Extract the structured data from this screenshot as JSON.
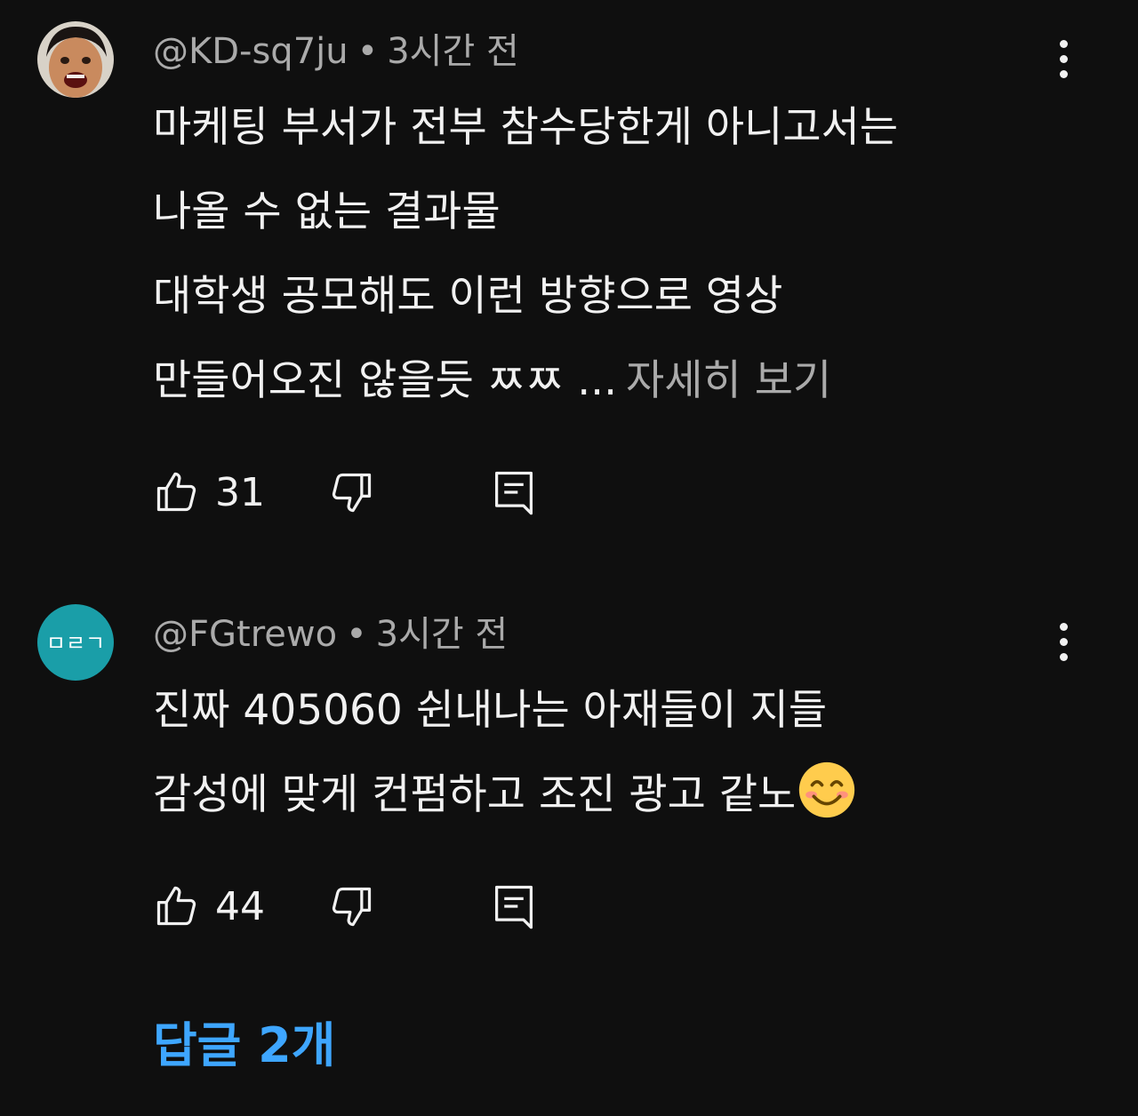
{
  "comments": [
    {
      "author": "@KD-sq7ju",
      "separator": "•",
      "time": "3시간 전",
      "lines": [
        "마케팅 부서가 전부 참수당한게 아니고서는",
        "나올 수 없는 결과물",
        "대학생 공모해도 이런 방향으로 영상",
        "만들어오진 않을듯 ㅉㅉ ..."
      ],
      "more_label": "자세히 보기",
      "likes": "31",
      "avatar_icon": "person-photo-avatar"
    },
    {
      "author": "@FGtrewo",
      "separator": "•",
      "time": "3시간 전",
      "lines": [
        "진짜 405060 쉰내나는 아재들이 지들",
        "감성에 맞게 컨펌하고 조진 광고 같노"
      ],
      "emoji": "smiling-face-emoji",
      "likes": "44",
      "avatar_text": "ㅁㄹㄱ",
      "avatar_color": "#1a9ea8"
    }
  ],
  "replies_label": "답글 2개",
  "colors": {
    "background": "#0f0f0f",
    "text": "#f1f1f1",
    "meta": "#aaaaaa",
    "link": "#3ea6ff"
  }
}
